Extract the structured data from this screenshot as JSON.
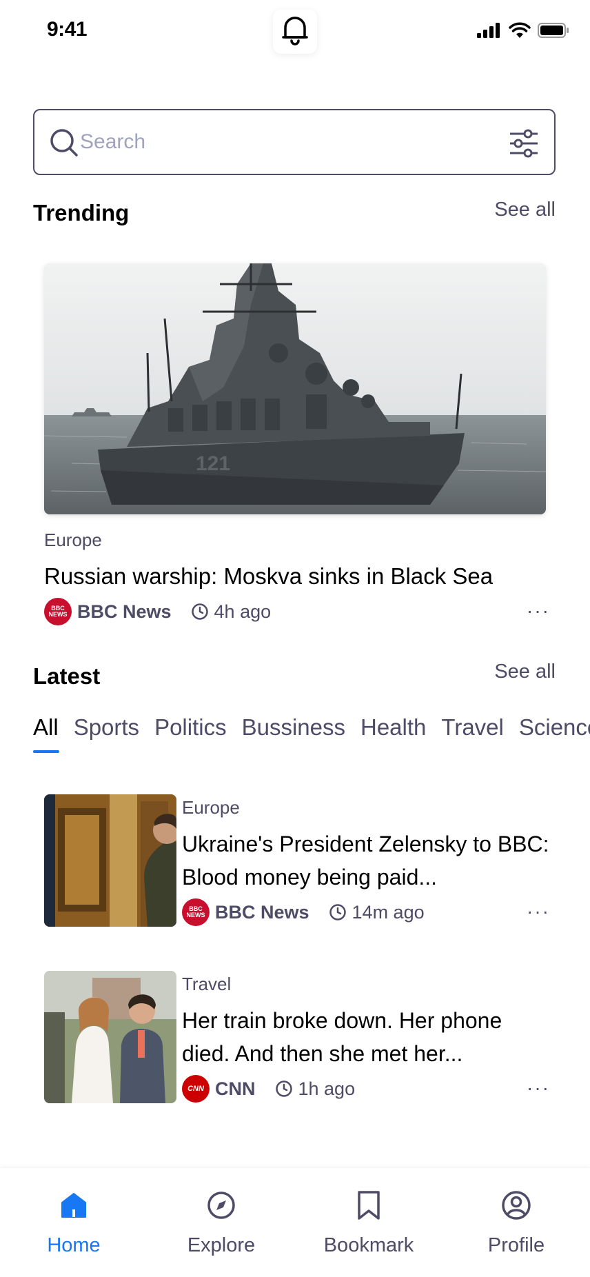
{
  "status_bar": {
    "time": "9:41"
  },
  "search": {
    "placeholder": "Search",
    "value": ""
  },
  "trending": {
    "title": "Trending",
    "see_all": "See all",
    "article": {
      "category": "Europe",
      "title": "Russian warship: Moskva sinks in Black Sea",
      "source": "BBC News",
      "source_logo_text": "BBC NEWS",
      "time": "4h ago",
      "more": "···"
    }
  },
  "latest": {
    "title": "Latest",
    "see_all": "See all",
    "tabs": [
      "All",
      "Sports",
      "Politics",
      "Bussiness",
      "Health",
      "Travel",
      "Science"
    ],
    "active_tab": "All",
    "articles": [
      {
        "category": "Europe",
        "title": "Ukraine's President Zelensky to BBC: Blood money being paid...",
        "source": "BBC News",
        "source_logo_text": "BBC NEWS",
        "time": "14m ago",
        "more": "···"
      },
      {
        "category": "Travel",
        "title": "Her train broke down. Her phone died. And then she met her...",
        "source": "CNN",
        "source_logo_text": "CNN",
        "time": "1h ago",
        "more": "···"
      }
    ]
  },
  "bottom_nav": {
    "items": [
      {
        "label": "Home",
        "icon": "home-icon",
        "active": true
      },
      {
        "label": "Explore",
        "icon": "compass-icon",
        "active": false
      },
      {
        "label": "Bookmark",
        "icon": "bookmark-icon",
        "active": false
      },
      {
        "label": "Profile",
        "icon": "profile-icon",
        "active": false
      }
    ]
  },
  "colors": {
    "accent": "#1877f2",
    "text_secondary": "#4e4b66",
    "placeholder": "#a0a3bd",
    "bbc_red": "#c8102e",
    "cnn_red": "#cc0000"
  }
}
